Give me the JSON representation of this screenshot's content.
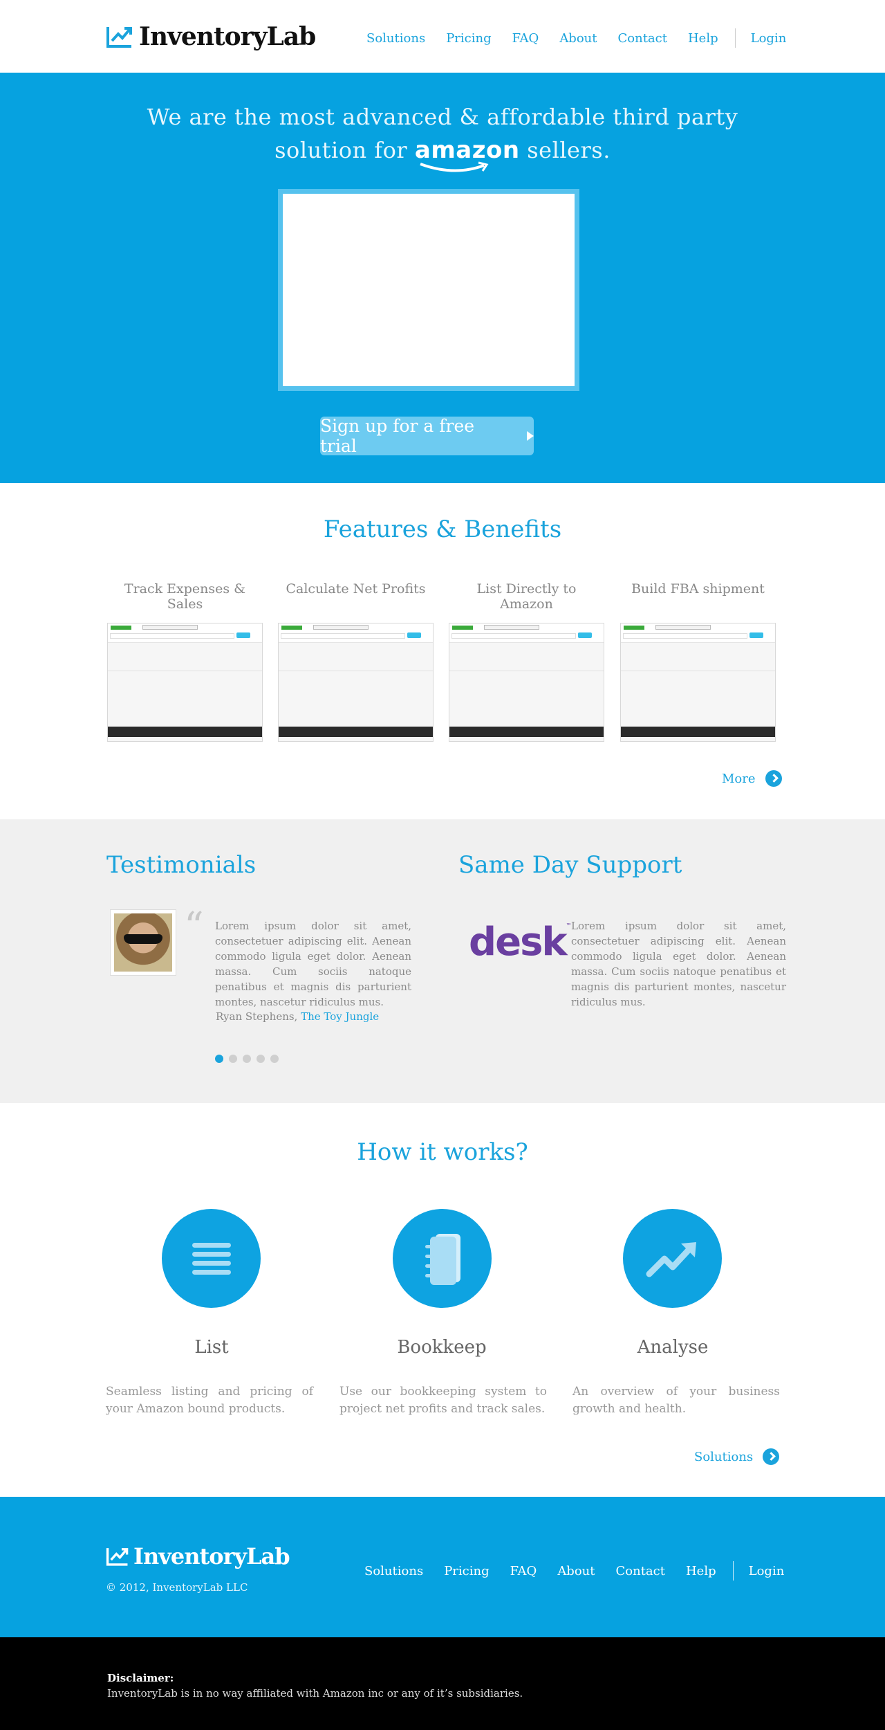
{
  "header": {
    "logo_text": "InventoryLab",
    "nav": [
      "Solutions",
      "Pricing",
      "FAQ",
      "About",
      "Contact",
      "Help"
    ],
    "login": "Login"
  },
  "hero": {
    "line1": "We are the most advanced & affordable third party",
    "line2_before": "solution for",
    "amazon_word": "amazon",
    "line2_after": "sellers.",
    "cta_label": "Sign up for a free trial"
  },
  "features": {
    "title": "Features & Benefits",
    "items": [
      {
        "label": "Track Expenses & Sales"
      },
      {
        "label": "Calculate Net Profits"
      },
      {
        "label": "List Directly to Amazon"
      },
      {
        "label": "Build FBA shipment"
      }
    ],
    "more_label": "More"
  },
  "testimonials": {
    "title": "Testimonials",
    "quote_mark": "“",
    "quote": "Lorem ipsum dolor sit amet, consectetuer adipiscing elit. Aenean commodo ligula eget dolor. Aenean massa. Cum sociis natoque penatibus et magnis dis parturient montes, nascetur ridiculus mus.",
    "author_name": "Ryan Stephens,",
    "author_company": "The Toy Jungle",
    "dots_total": 5,
    "dots_active": 1
  },
  "support": {
    "title": "Same Day Support",
    "logo_text": "desk",
    "logo_tm": "™",
    "text": "Lorem ipsum dolor sit amet, consectetuer adipiscing elit. Aenean commodo ligula eget dolor. Aenean massa. Cum sociis natoque penatibus et magnis dis parturient montes, nascetur ridiculus mus."
  },
  "how": {
    "title": "How it works?",
    "steps": [
      {
        "label": "List",
        "icon": "list-icon",
        "text": "Seamless listing and pricing of your Amazon bound products."
      },
      {
        "label": "Bookkeep",
        "icon": "notebook-icon",
        "text": "Use our bookkeeping system to project net profits and track sales."
      },
      {
        "label": "Analyse",
        "icon": "trend-arrow-icon",
        "text": "An overview of your business growth and health."
      }
    ],
    "solutions_label": "Solutions"
  },
  "footer": {
    "logo_text": "InventoryLab",
    "copyright": "© 2012, InventoryLab LLC",
    "nav": [
      "Solutions",
      "Pricing",
      "FAQ",
      "About",
      "Contact",
      "Help"
    ],
    "login": "Login"
  },
  "disclaimer": {
    "title": "Disclaimer:",
    "text": "InventoryLab is in no way affiliated with Amazon inc or any of it’s subsidiaries."
  },
  "colors": {
    "brand_blue": "#06a2e0",
    "link_blue": "#1aa3dc",
    "band_gray": "#f0f0f0",
    "desk_purple": "#6a3fa0"
  }
}
